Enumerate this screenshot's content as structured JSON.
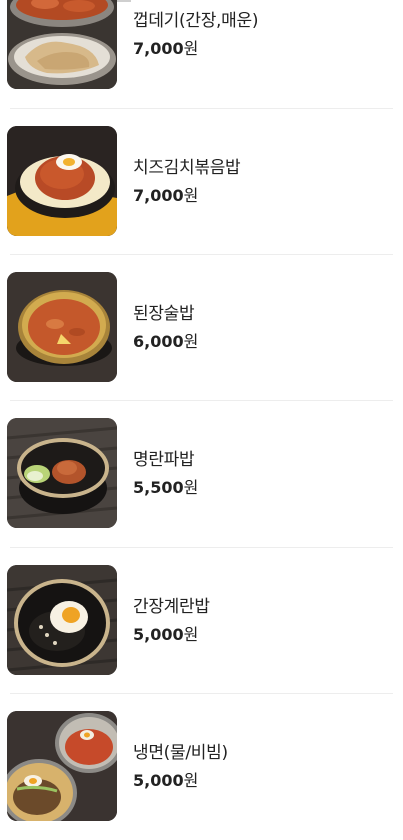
{
  "menu": {
    "items": [
      {
        "name": "껍데기(간장,매운)",
        "price": "7,000",
        "currency": "원",
        "image": "grilled-pork-skin-photo"
      },
      {
        "name": "치즈김치볶음밥",
        "price": "7,000",
        "currency": "원",
        "image": "cheese-kimchi-fried-rice-photo"
      },
      {
        "name": "된장술밥",
        "price": "6,000",
        "currency": "원",
        "image": "doenjang-rice-soup-photo"
      },
      {
        "name": "명란파밥",
        "price": "5,500",
        "currency": "원",
        "image": "pollock-roe-scallion-rice-photo"
      },
      {
        "name": "간장계란밥",
        "price": "5,000",
        "currency": "원",
        "image": "soy-sauce-egg-rice-photo"
      },
      {
        "name": "냉면(물/비빔)",
        "price": "5,000",
        "currency": "원",
        "image": "cold-noodles-photo"
      }
    ]
  },
  "colors": {
    "text": "#222222",
    "divider": "#ededed"
  }
}
